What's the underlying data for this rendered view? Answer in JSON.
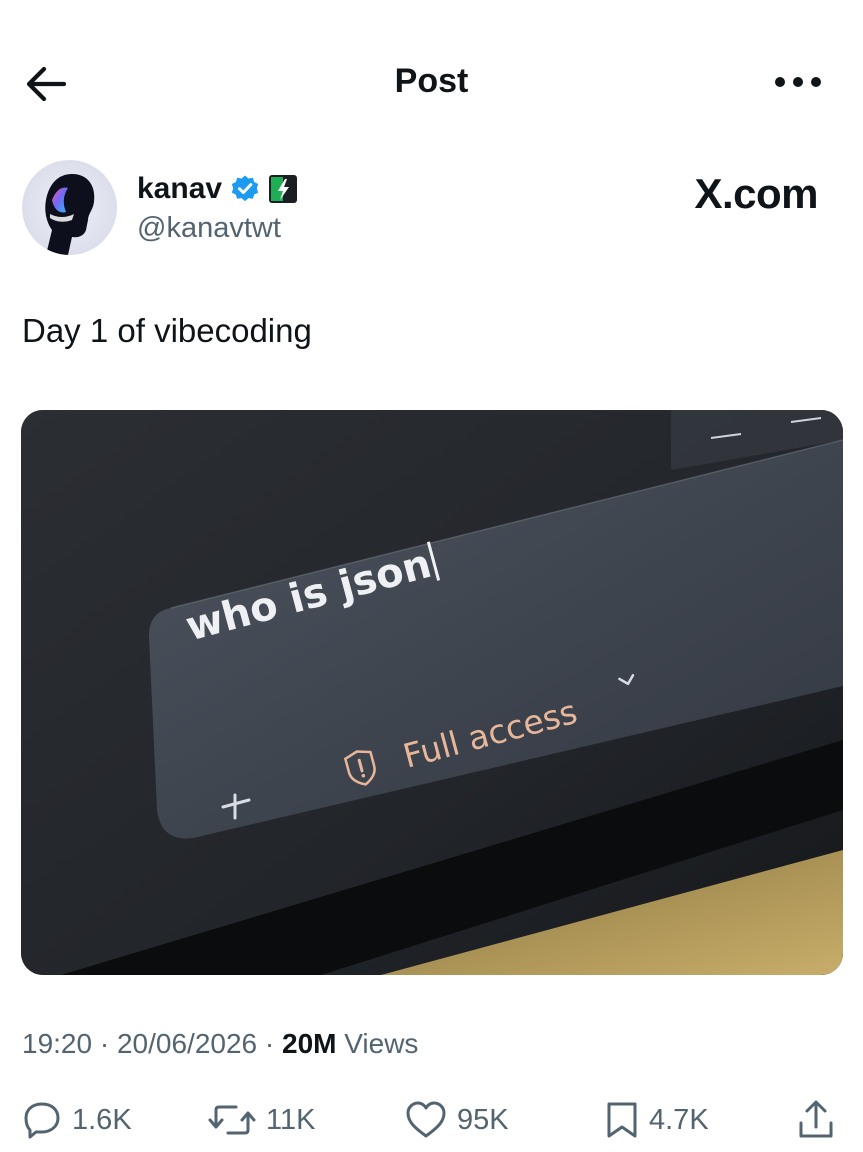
{
  "header": {
    "title": "Post",
    "back_icon": "back-arrow-icon",
    "more_icon": "more-horizontal-icon"
  },
  "author": {
    "name": "kanav",
    "handle": "@kanavtwt",
    "verified_color": "#1d9bf0",
    "badge_icon": "lightning-badge-icon"
  },
  "watermark": "X.com",
  "post": {
    "text": "Day 1 of vibecoding"
  },
  "media": {
    "input_text": "who is json",
    "add_symbol": "+",
    "access_label": "Full access"
  },
  "meta": {
    "time": "19:20",
    "sep1": " · ",
    "date": "20/06/2026",
    "sep2": " · ",
    "views_count": "20M",
    "views_label": " Views"
  },
  "actions": {
    "replies": "1.6K",
    "reposts": "11K",
    "likes": "95K",
    "bookmarks": "4.7K"
  },
  "colors": {
    "text_primary": "#0f1419",
    "text_secondary": "#536471",
    "verified": "#1d9bf0",
    "access_accent": "#e8b79a"
  }
}
